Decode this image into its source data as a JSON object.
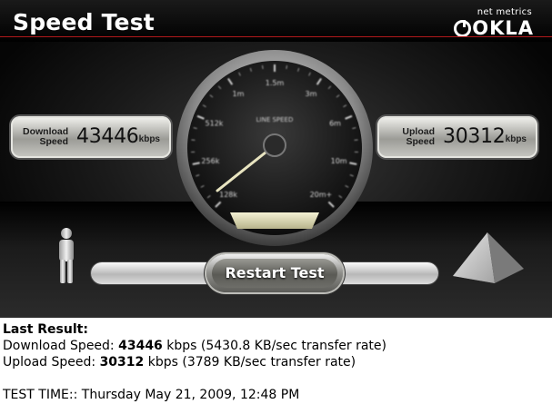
{
  "widget": {
    "title": "Speed Test",
    "brand_sub": "net metrics",
    "brand_logo": "OKLA",
    "colors": {
      "accent_line": "#b0191b",
      "background": "#000000"
    }
  },
  "download_panel": {
    "label_line1": "Download",
    "label_line2": "Speed",
    "value": "43446",
    "unit": "kbps"
  },
  "upload_panel": {
    "label_line1": "Upload",
    "label_line2": "Speed",
    "value": "30312",
    "unit": "kbps"
  },
  "gauge": {
    "title": "LINE SPEED",
    "tick_labels": [
      "128k",
      "256k",
      "512k",
      "1m",
      "1.5m",
      "3m",
      "6m",
      "10m",
      "20m+"
    ],
    "needle_reading": "256k"
  },
  "controls": {
    "restart_label": "Restart Test",
    "icons": [
      "person-icon",
      "pyramid-icon"
    ]
  },
  "results": {
    "heading": "Last Result:",
    "download_prefix": "Download Speed: ",
    "download_value": "43446",
    "download_suffix": " kbps (5430.8 KB/sec transfer rate)",
    "upload_prefix": "Upload Speed: ",
    "upload_value": "30312",
    "upload_suffix": " kbps (3789 KB/sec transfer rate)",
    "test_time": "TEST TIME:: Thursday May 21, 2009, 12:48 PM"
  }
}
